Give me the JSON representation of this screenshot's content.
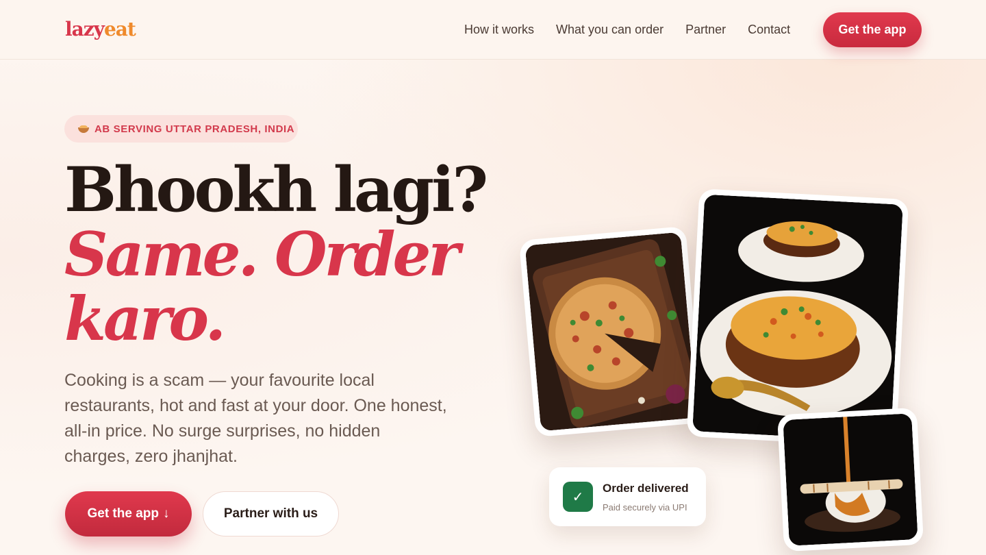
{
  "header": {
    "logo_part1": "lazy",
    "logo_part2": "eat",
    "nav": [
      "How it works",
      "What you can order",
      "Partner",
      "Contact"
    ],
    "cta_label": "Get the app"
  },
  "hero": {
    "badge_icon": "cooking-pot-icon",
    "badge": "AB SERVING UTTAR PRADESH, INDIA",
    "headline_line1": "Bhookh lagi?",
    "headline_line2": "Same. Order",
    "headline_line3": "karo.",
    "lead": "Cooking is a scam — your favourite local restaurants, hot and fast at your door. One honest, all-in price. No surge surprises, no hidden charges, zero jhanjhat.",
    "primary_cta": "Get the app",
    "primary_cta_icon": "↓",
    "secondary_cta": "Partner with us"
  },
  "gallery": {
    "items": [
      "pizza-photo",
      "biryani-photo",
      "dessert-photo"
    ]
  },
  "toast": {
    "icon": "check-icon",
    "title": "Order delivered",
    "subtitle": "Paid securely via UPI"
  },
  "colors": {
    "brand_red": "#d8364b",
    "brand_orange": "#ef8a2c",
    "success_green": "#1f7a47",
    "background": "#fdf6f1"
  }
}
